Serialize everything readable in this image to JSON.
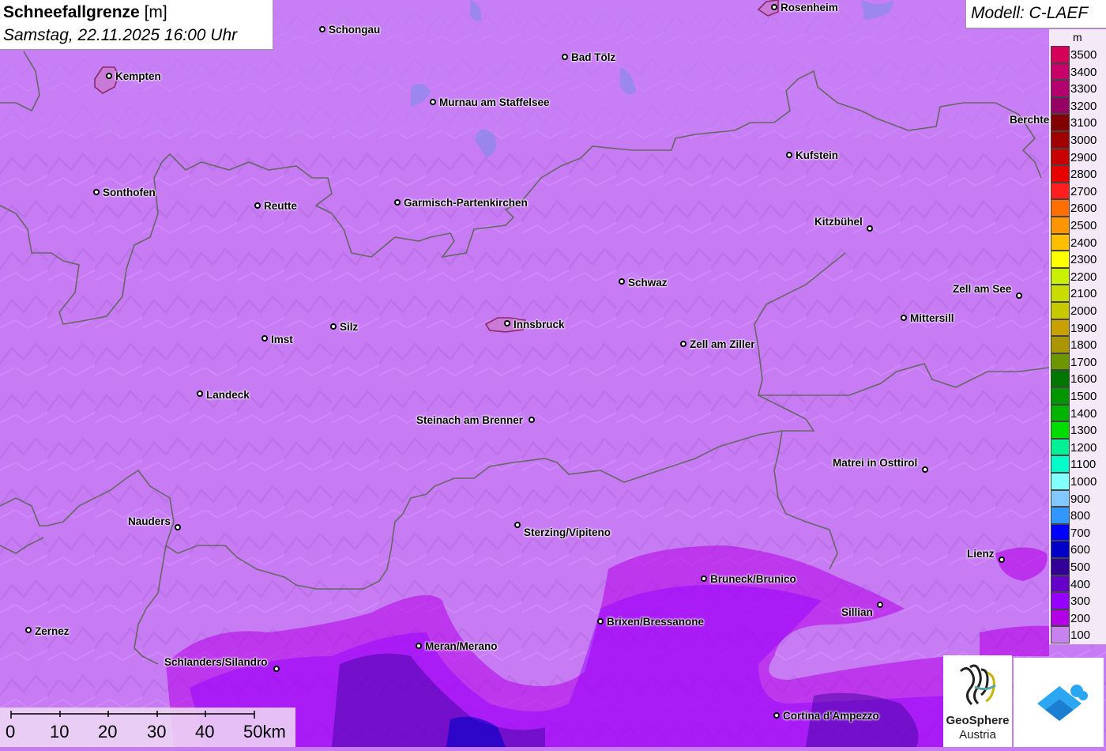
{
  "title": {
    "parameter": "Schneefallgrenze",
    "unit": "[m]",
    "datetime": "Samstag, 22.11.2025 16:00 Uhr"
  },
  "model": "Modell: C-LAEF",
  "legend": {
    "unit": "m",
    "entries": [
      {
        "label": "3500",
        "color": "#d4005a"
      },
      {
        "label": "3400",
        "color": "#c8006a"
      },
      {
        "label": "3300",
        "color": "#b4006e"
      },
      {
        "label": "3200",
        "color": "#960064"
      },
      {
        "label": "3100",
        "color": "#820000"
      },
      {
        "label": "3000",
        "color": "#a00000"
      },
      {
        "label": "2900",
        "color": "#c80000"
      },
      {
        "label": "2800",
        "color": "#e60000"
      },
      {
        "label": "2700",
        "color": "#ff1e1e"
      },
      {
        "label": "2600",
        "color": "#ff6e00"
      },
      {
        "label": "2500",
        "color": "#ff9600"
      },
      {
        "label": "2400",
        "color": "#ffbe00"
      },
      {
        "label": "2300",
        "color": "#ffff00"
      },
      {
        "label": "2200",
        "color": "#c8f000"
      },
      {
        "label": "2100",
        "color": "#c8dc00"
      },
      {
        "label": "2000",
        "color": "#c8c800"
      },
      {
        "label": "1900",
        "color": "#c8a000"
      },
      {
        "label": "1800",
        "color": "#aa9600"
      },
      {
        "label": "1700",
        "color": "#6e9600"
      },
      {
        "label": "1600",
        "color": "#007800"
      },
      {
        "label": "1500",
        "color": "#009600"
      },
      {
        "label": "1400",
        "color": "#00b400"
      },
      {
        "label": "1300",
        "color": "#00dc00"
      },
      {
        "label": "1200",
        "color": "#00f096"
      },
      {
        "label": "1100",
        "color": "#00ffc8"
      },
      {
        "label": "1000",
        "color": "#82ffff"
      },
      {
        "label": "900",
        "color": "#82c8ff"
      },
      {
        "label": "800",
        "color": "#3296ff"
      },
      {
        "label": "700",
        "color": "#0000ff"
      },
      {
        "label": "600",
        "color": "#0000c8"
      },
      {
        "label": "500",
        "color": "#320096"
      },
      {
        "label": "400",
        "color": "#6400c8"
      },
      {
        "label": "300",
        "color": "#9600ff"
      },
      {
        "label": "200",
        "color": "#b400e6"
      },
      {
        "label": "100",
        "color": "#c882f0"
      }
    ]
  },
  "cities": [
    "Rosenheim",
    "Schongau",
    "Kempten",
    "Bad Tölz",
    "Murnau am Staffelsee",
    "Berchte",
    "Kufstein",
    "Sonthofen",
    "Reutte",
    "Garmisch-Partenkirchen",
    "Kitzbühel",
    "Schwaz",
    "Zell am See",
    "Mittersill",
    "Innsbruck",
    "Silz",
    "Imst",
    "Zell am Ziller",
    "Landeck",
    "Steinach am Brenner",
    "Matrei in Osttirol",
    "Nauders",
    "Sterzing/Vipiteno",
    "Lienz",
    "Bruneck/Brunico",
    "Sillian",
    "Brixen/Bressanone",
    "Zernez",
    "Meran/Merano",
    "Schlanders/Silandro",
    "Cortina d'Ampezzo"
  ],
  "scale": {
    "labels": [
      "0",
      "10",
      "20",
      "30",
      "40",
      "50km"
    ]
  },
  "logos": {
    "geosphere_name": "GeoSphere",
    "geosphere_sub": "Austria"
  }
}
